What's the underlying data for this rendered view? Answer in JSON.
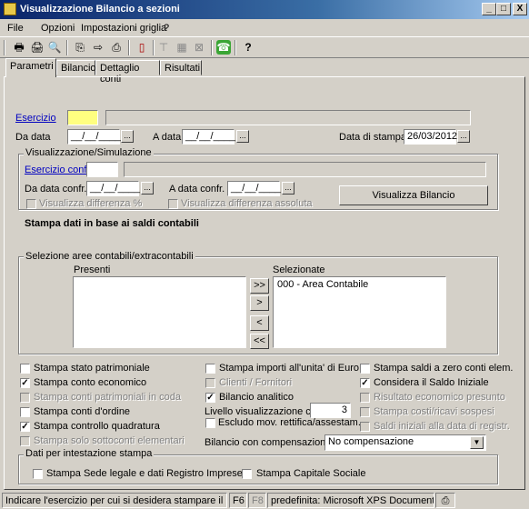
{
  "window": {
    "title": "Visualizzazione Bilancio a sezioni",
    "controls": [
      "_",
      "□",
      "X"
    ]
  },
  "menu": [
    "File",
    "Opzioni",
    "Impostazioni griglia",
    "?"
  ],
  "tabs": [
    "Parametri",
    "Bilancio",
    "Dettaglio conti",
    "Risultati"
  ],
  "form": {
    "esercizio_label": "Esercizio",
    "da_data_label": "Da data",
    "da_data_value": "__/__/____",
    "a_data_label": "A data",
    "a_data_value": "__/__/____",
    "data_stampa_label": "Data di stampa",
    "data_stampa_value": "26/03/2012",
    "dots": "..."
  },
  "simulazione": {
    "title": "Visualizzazione/Simulazione",
    "esercizio_confr_label": "Esercizio confr.",
    "da_data_confr_label": "Da data confr.",
    "da_data_confr_value": "__/__/____",
    "a_data_confr_label": "A data confr.",
    "a_data_confr_value": "__/__/____",
    "diff_pct_label": "Visualizza differenza %",
    "diff_abs_label": "Visualizza differenza assoluta",
    "visualizza_button": "Visualizza Bilancio"
  },
  "stampa_heading": "Stampa dati in base ai saldi contabili",
  "aree": {
    "title": "Selezione aree contabili/extracontabili",
    "presenti_label": "Presenti",
    "selezionate_label": "Selezionate",
    "selezionate_items": [
      "000 - Area Contabile"
    ],
    "btn_all_right": ">>",
    "btn_right": ">",
    "btn_left": "<",
    "btn_all_left": "<<"
  },
  "options": {
    "col1": [
      {
        "label": "Stampa stato patrimoniale",
        "checked": false,
        "disabled": false
      },
      {
        "label": "Stampa conto economico",
        "checked": true,
        "disabled": false
      },
      {
        "label": "Stampa conti patrimoniali in coda",
        "checked": false,
        "disabled": true
      },
      {
        "label": "Stampa conti d'ordine",
        "checked": false,
        "disabled": false
      },
      {
        "label": "Stampa controllo quadratura",
        "checked": true,
        "disabled": false
      },
      {
        "label": "Stampa solo sottoconti elementari",
        "checked": false,
        "disabled": true
      }
    ],
    "col2": [
      {
        "label": "Stampa importi all'unita' di Euro",
        "checked": false,
        "disabled": false
      },
      {
        "label": "Clienti / Fornitori",
        "checked": false,
        "disabled": true
      },
      {
        "label": "Bilancio analitico",
        "checked": true,
        "disabled": false
      }
    ],
    "livello_label": "Livello visualizzazione conti",
    "livello_value": "3",
    "escludo_label": "Escludo mov. rettifica/assestam.",
    "compensazione_label": "Bilancio con compensazione",
    "compensazione_value": "No compensazione",
    "col3": [
      {
        "label": "Stampa saldi a zero conti elem.",
        "checked": false,
        "disabled": false
      },
      {
        "label": "Considera il Saldo Iniziale",
        "checked": true,
        "disabled": false
      },
      {
        "label": "Risultato economico presunto",
        "checked": false,
        "disabled": true
      },
      {
        "label": "Stampa costi/ricavi sospesi",
        "checked": false,
        "disabled": true
      },
      {
        "label": "Saldi iniziali alla data di registr.",
        "checked": false,
        "disabled": true
      }
    ]
  },
  "intestazione": {
    "title": "Dati per intestazione stampa",
    "sede_label": "Stampa Sede legale e dati Registro Imprese",
    "capitale_label": "Stampa Capitale Sociale"
  },
  "status": {
    "message": "Indicare l'esercizio per cui si desidera stampare il bilancio",
    "f6": "F6",
    "f8": "F8",
    "printer": "predefinita: Microsoft XPS Document Writer"
  }
}
